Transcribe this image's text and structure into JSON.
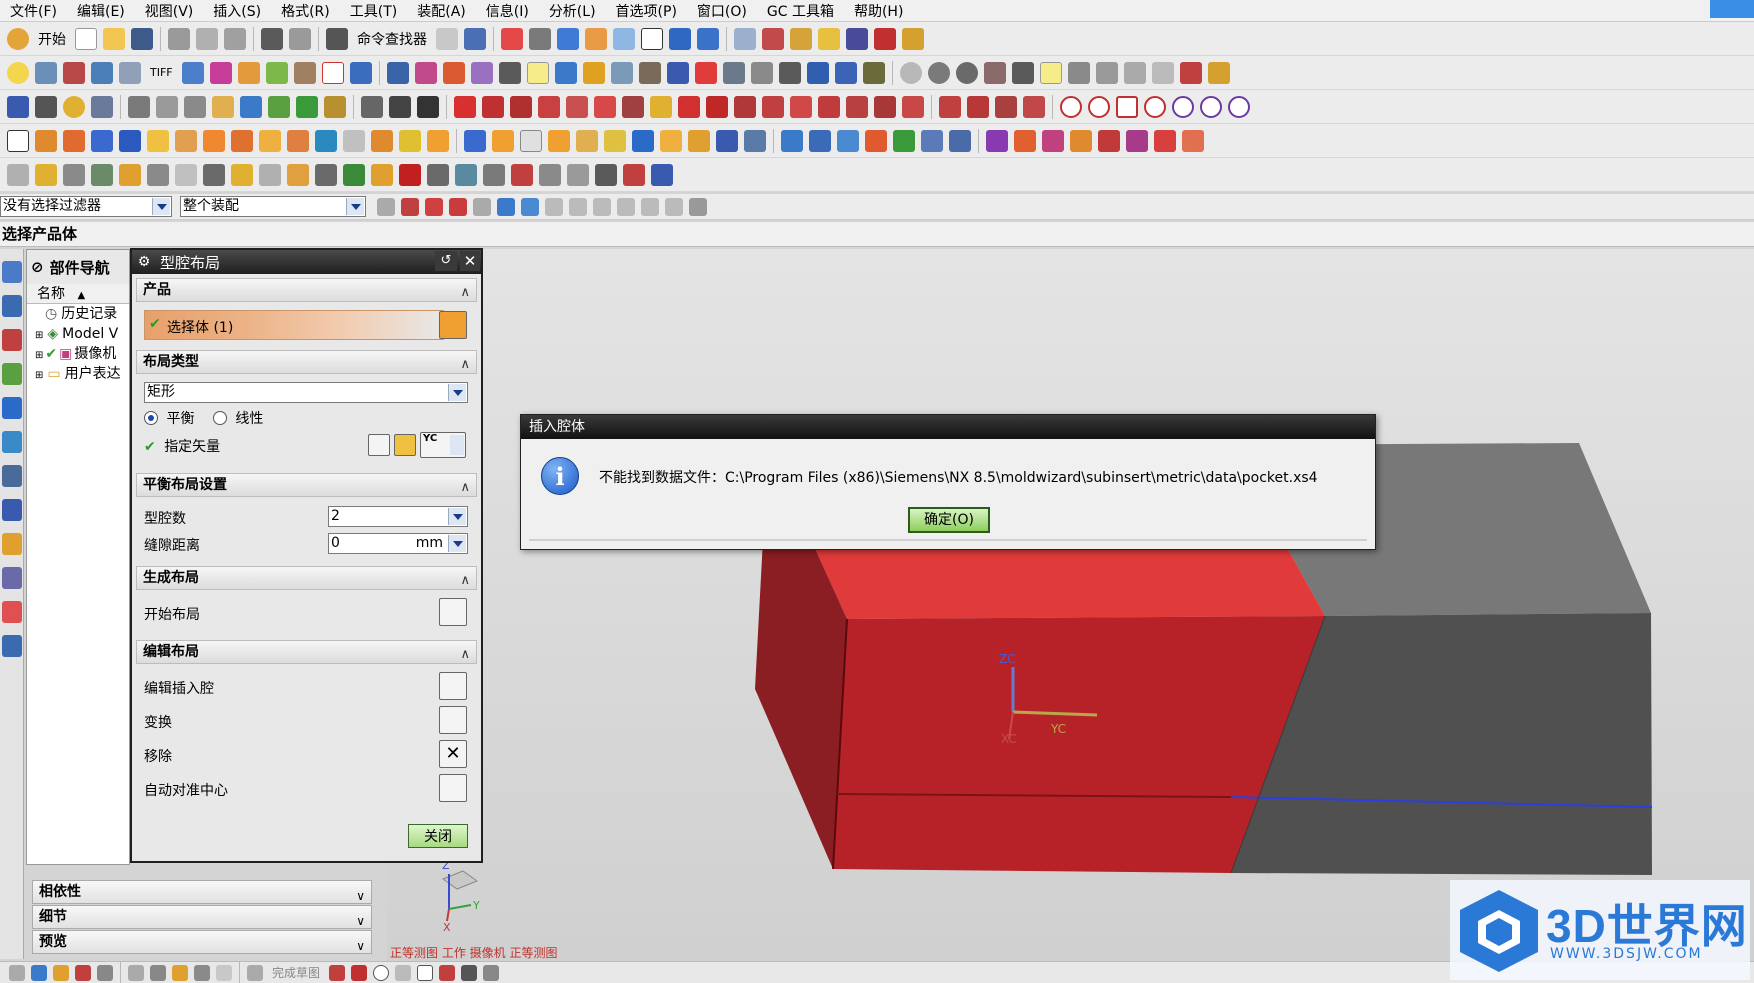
{
  "menu": [
    "文件(F)",
    "编辑(E)",
    "视图(V)",
    "插入(S)",
    "格式(R)",
    "工具(T)",
    "装配(A)",
    "信息(I)",
    "分析(L)",
    "首选项(P)",
    "窗口(O)",
    "GC 工具箱",
    "帮助(H)"
  ],
  "toolbar": {
    "start_label": "开始",
    "command_finder_label": "命令查找器"
  },
  "selection_bar": {
    "filter_value": "没有选择过滤器",
    "scope_value": "整个装配"
  },
  "prompt": "选择产品体",
  "part_navigator": {
    "title": "部件导航",
    "column_name": "名称",
    "items": [
      "历史记录",
      "Model V",
      "摄像机",
      "用户表达"
    ]
  },
  "bottom_panels": [
    "相依性",
    "细节",
    "预览"
  ],
  "cavity_dialog": {
    "title": "型腔布局",
    "product_section": "产品",
    "select_body_label": "选择体 (1)",
    "layout_type_section": "布局类型",
    "layout_type_value": "矩形",
    "radio_balanced": "平衡",
    "radio_linear": "线性",
    "specify_vector_label": "指定矢量",
    "vector_value": "YC",
    "balanced_settings_section": "平衡布局设置",
    "cavity_count_label": "型腔数",
    "cavity_count_value": "2",
    "gap_distance_label": "缝隙距离",
    "gap_distance_value": "0",
    "gap_unit": "mm",
    "generate_section": "生成布局",
    "start_layout_label": "开始布局",
    "edit_section": "编辑布局",
    "edit_insert_label": "编辑插入腔",
    "transform_label": "变换",
    "remove_label": "移除",
    "auto_center_label": "自动对准中心",
    "close_button": "关闭"
  },
  "message_box": {
    "title": "插入腔体",
    "message": "不能找到数据文件：C:\\Program Files (x86)\\Siemens\\NX 8.5\\moldwizard\\subinsert\\metric\\data\\pocket.xs4",
    "ok_button": "确定(O)"
  },
  "viewport": {
    "axis_zc": "ZC",
    "axis_yc": "YC",
    "axis_xc": "XC",
    "triad_z": "Z",
    "triad_y": "Y",
    "triad_x": "X",
    "status_text": "正等测图 工作 摄像机 正等测图",
    "model_colors": {
      "cavity": "#d9262b",
      "block": "#505050",
      "edge": "#2a3fe0"
    }
  },
  "bottom_toolbar": {
    "sketch_label": "完成草图"
  },
  "watermark": {
    "text": "3D世界网",
    "url": "WWW.3DSJW.COM"
  }
}
